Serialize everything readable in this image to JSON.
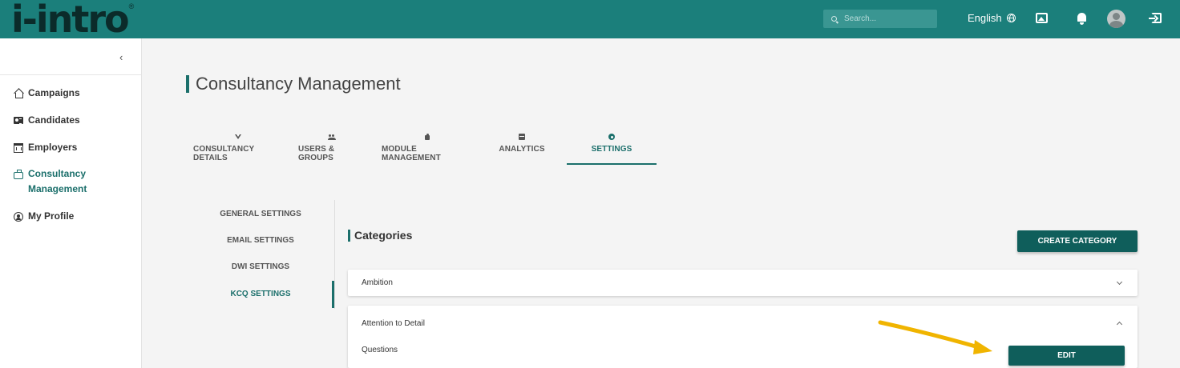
{
  "header": {
    "logo_text": "i-intro",
    "logo_mark": "®",
    "search_placeholder": "Search...",
    "language": "English",
    "icons": [
      "search-icon",
      "globe-icon",
      "gallery-icon",
      "bell-icon",
      "avatar",
      "logout-icon"
    ],
    "colors": {
      "bar": "#1b7f7b",
      "accent": "#1b6f6b",
      "button": "#0f5e5b"
    }
  },
  "sidebar": {
    "collapse": "‹",
    "items": [
      {
        "label": "Campaigns",
        "icon": "home-icon"
      },
      {
        "label": "Candidates",
        "icon": "id-card-icon"
      },
      {
        "label": "Employers",
        "icon": "building-icon"
      },
      {
        "label": "Consultancy Management",
        "line1": "Consultancy",
        "line2": "Management",
        "icon": "briefcase-icon",
        "active": true
      },
      {
        "label": "My Profile",
        "icon": "profile-icon"
      }
    ]
  },
  "main": {
    "title": "Consultancy Management",
    "tabs": [
      {
        "label": "CONSULTANCY DETAILS",
        "icon": "filter-icon"
      },
      {
        "label": "USERS & GROUPS",
        "icon": "users-icon"
      },
      {
        "label": "MODULE MANAGEMENT",
        "icon": "puzzle-icon"
      },
      {
        "label": "ANALYTICS",
        "icon": "chart-icon"
      },
      {
        "label": "SETTINGS",
        "icon": "gear-icon",
        "active": true
      }
    ],
    "settings_nav": [
      {
        "label": "GENERAL SETTINGS"
      },
      {
        "label": "EMAIL SETTINGS"
      },
      {
        "label": "DWI SETTINGS"
      },
      {
        "label": "KCQ SETTINGS",
        "active": true
      }
    ],
    "categories": {
      "title": "Categories",
      "create_label": "CREATE CATEGORY",
      "items": [
        {
          "name": "Ambition",
          "expanded": false
        },
        {
          "name": "Attention to Detail",
          "expanded": true,
          "section_label": "Questions",
          "edit_label": "EDIT"
        }
      ]
    }
  }
}
